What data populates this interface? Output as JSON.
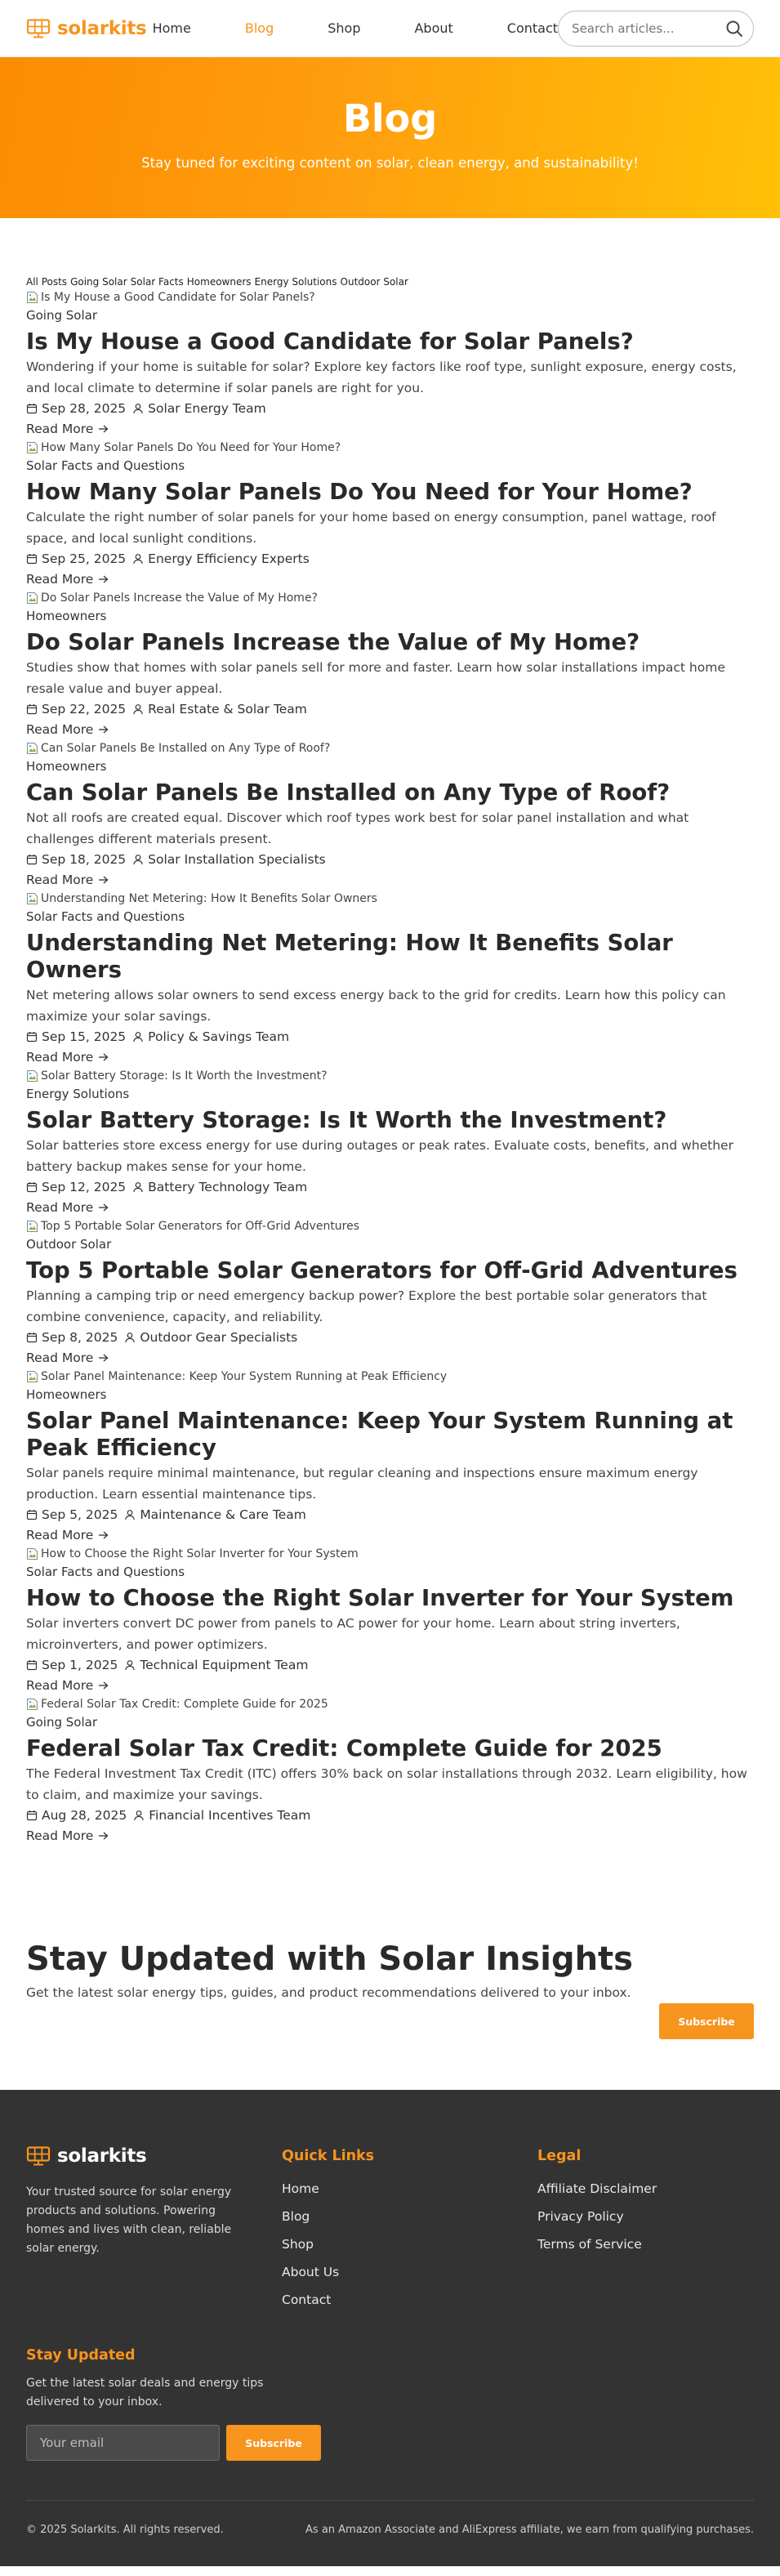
{
  "brand": {
    "name": "solarkits",
    "color": "#f7941d"
  },
  "nav": [
    {
      "label": "Home",
      "active": false
    },
    {
      "label": "Blog",
      "active": true
    },
    {
      "label": "Shop",
      "active": false
    },
    {
      "label": "About",
      "active": false
    },
    {
      "label": "Contact",
      "active": false
    }
  ],
  "search": {
    "placeholder": "Search articles..."
  },
  "hero": {
    "title": "Blog",
    "subtitle": "Stay tuned for exciting content on solar, clean energy, and sustainability!"
  },
  "filters": [
    "All Posts",
    "Going Solar",
    "Solar Facts",
    "Homeowners",
    "Energy Solutions",
    "Outdoor Solar"
  ],
  "posts": [
    {
      "image_alt": "Is My House a Good Candidate for Solar Panels?",
      "category": "Going Solar",
      "title": "Is My House a Good Candidate for Solar Panels?",
      "excerpt": "Wondering if your home is suitable for solar? Explore key factors like roof type, sunlight exposure, energy costs, and local climate to determine if solar panels are right for you.",
      "date": "Sep 28, 2025",
      "author": "Solar Energy Team",
      "read_more": "Read More"
    },
    {
      "image_alt": "How Many Solar Panels Do You Need for Your Home?",
      "category": "Solar Facts and Questions",
      "title": "How Many Solar Panels Do You Need for Your Home?",
      "excerpt": "Calculate the right number of solar panels for your home based on energy consumption, panel wattage, roof space, and local sunlight conditions.",
      "date": "Sep 25, 2025",
      "author": "Energy Efficiency Experts",
      "read_more": "Read More"
    },
    {
      "image_alt": "Do Solar Panels Increase the Value of My Home?",
      "category": "Homeowners",
      "title": "Do Solar Panels Increase the Value of My Home?",
      "excerpt": "Studies show that homes with solar panels sell for more and faster. Learn how solar installations impact home resale value and buyer appeal.",
      "date": "Sep 22, 2025",
      "author": "Real Estate & Solar Team",
      "read_more": "Read More"
    },
    {
      "image_alt": "Can Solar Panels Be Installed on Any Type of Roof?",
      "category": "Homeowners",
      "title": "Can Solar Panels Be Installed on Any Type of Roof?",
      "excerpt": "Not all roofs are created equal. Discover which roof types work best for solar panel installation and what challenges different materials present.",
      "date": "Sep 18, 2025",
      "author": "Solar Installation Specialists",
      "read_more": "Read More"
    },
    {
      "image_alt": "Understanding Net Metering: How It Benefits Solar Owners",
      "category": "Solar Facts and Questions",
      "title": "Understanding Net Metering: How It Benefits Solar Owners",
      "excerpt": "Net metering allows solar owners to send excess energy back to the grid for credits. Learn how this policy can maximize your solar savings.",
      "date": "Sep 15, 2025",
      "author": "Policy & Savings Team",
      "read_more": "Read More"
    },
    {
      "image_alt": "Solar Battery Storage: Is It Worth the Investment?",
      "category": "Energy Solutions",
      "title": "Solar Battery Storage: Is It Worth the Investment?",
      "excerpt": "Solar batteries store excess energy for use during outages or peak rates. Evaluate costs, benefits, and whether battery backup makes sense for your home.",
      "date": "Sep 12, 2025",
      "author": "Battery Technology Team",
      "read_more": "Read More"
    },
    {
      "image_alt": "Top 5 Portable Solar Generators for Off-Grid Adventures",
      "category": "Outdoor Solar",
      "title": "Top 5 Portable Solar Generators for Off-Grid Adventures",
      "excerpt": "Planning a camping trip or need emergency backup power? Explore the best portable solar generators that combine convenience, capacity, and reliability.",
      "date": "Sep 8, 2025",
      "author": "Outdoor Gear Specialists",
      "read_more": "Read More"
    },
    {
      "image_alt": "Solar Panel Maintenance: Keep Your System Running at Peak Efficiency",
      "category": "Homeowners",
      "title": "Solar Panel Maintenance: Keep Your System Running at Peak Efficiency",
      "excerpt": "Solar panels require minimal maintenance, but regular cleaning and inspections ensure maximum energy production. Learn essential maintenance tips.",
      "date": "Sep 5, 2025",
      "author": "Maintenance & Care Team",
      "read_more": "Read More"
    },
    {
      "image_alt": "How to Choose the Right Solar Inverter for Your System",
      "category": "Solar Facts and Questions",
      "title": "How to Choose the Right Solar Inverter for Your System",
      "excerpt": "Solar inverters convert DC power from panels to AC power for your home. Learn about string inverters, microinverters, and power optimizers.",
      "date": "Sep 1, 2025",
      "author": "Technical Equipment Team",
      "read_more": "Read More"
    },
    {
      "image_alt": "Federal Solar Tax Credit: Complete Guide for 2025",
      "category": "Going Solar",
      "title": "Federal Solar Tax Credit: Complete Guide for 2025",
      "excerpt": "The Federal Investment Tax Credit (ITC) offers 30% back on solar installations through 2032. Learn eligibility, how to claim, and maximize your savings.",
      "date": "Aug 28, 2025",
      "author": "Financial Incentives Team",
      "read_more": "Read More"
    }
  ],
  "newsletter": {
    "title": "Stay Updated with Solar Insights",
    "text": "Get the latest solar energy tips, guides, and product recommendations delivered to your inbox.",
    "button": "Subscribe"
  },
  "footer": {
    "brand": "solarkits",
    "description": "Your trusted source for solar energy products and solutions. Powering homes and lives with clean, reliable solar energy.",
    "quick_links_title": "Quick Links",
    "quick_links": [
      "Home",
      "Blog",
      "Shop",
      "About Us",
      "Contact"
    ],
    "legal_title": "Legal",
    "legal_links": [
      "Affiliate Disclaimer",
      "Privacy Policy",
      "Terms of Service"
    ],
    "stay_title": "Stay Updated",
    "stay_text": "Get the latest solar deals and energy tips delivered to your inbox.",
    "email_placeholder": "Your email",
    "subscribe": "Subscribe",
    "copyright": "© 2025 Solarkits. All rights reserved.",
    "affiliate_note": "As an Amazon Associate and AliExpress affiliate, we earn from qualifying purchases."
  },
  "colors": {
    "accent": "#f7941d",
    "hero_start": "#fb8c00",
    "hero_end": "#ffc107",
    "footer_bg": "#333333"
  }
}
